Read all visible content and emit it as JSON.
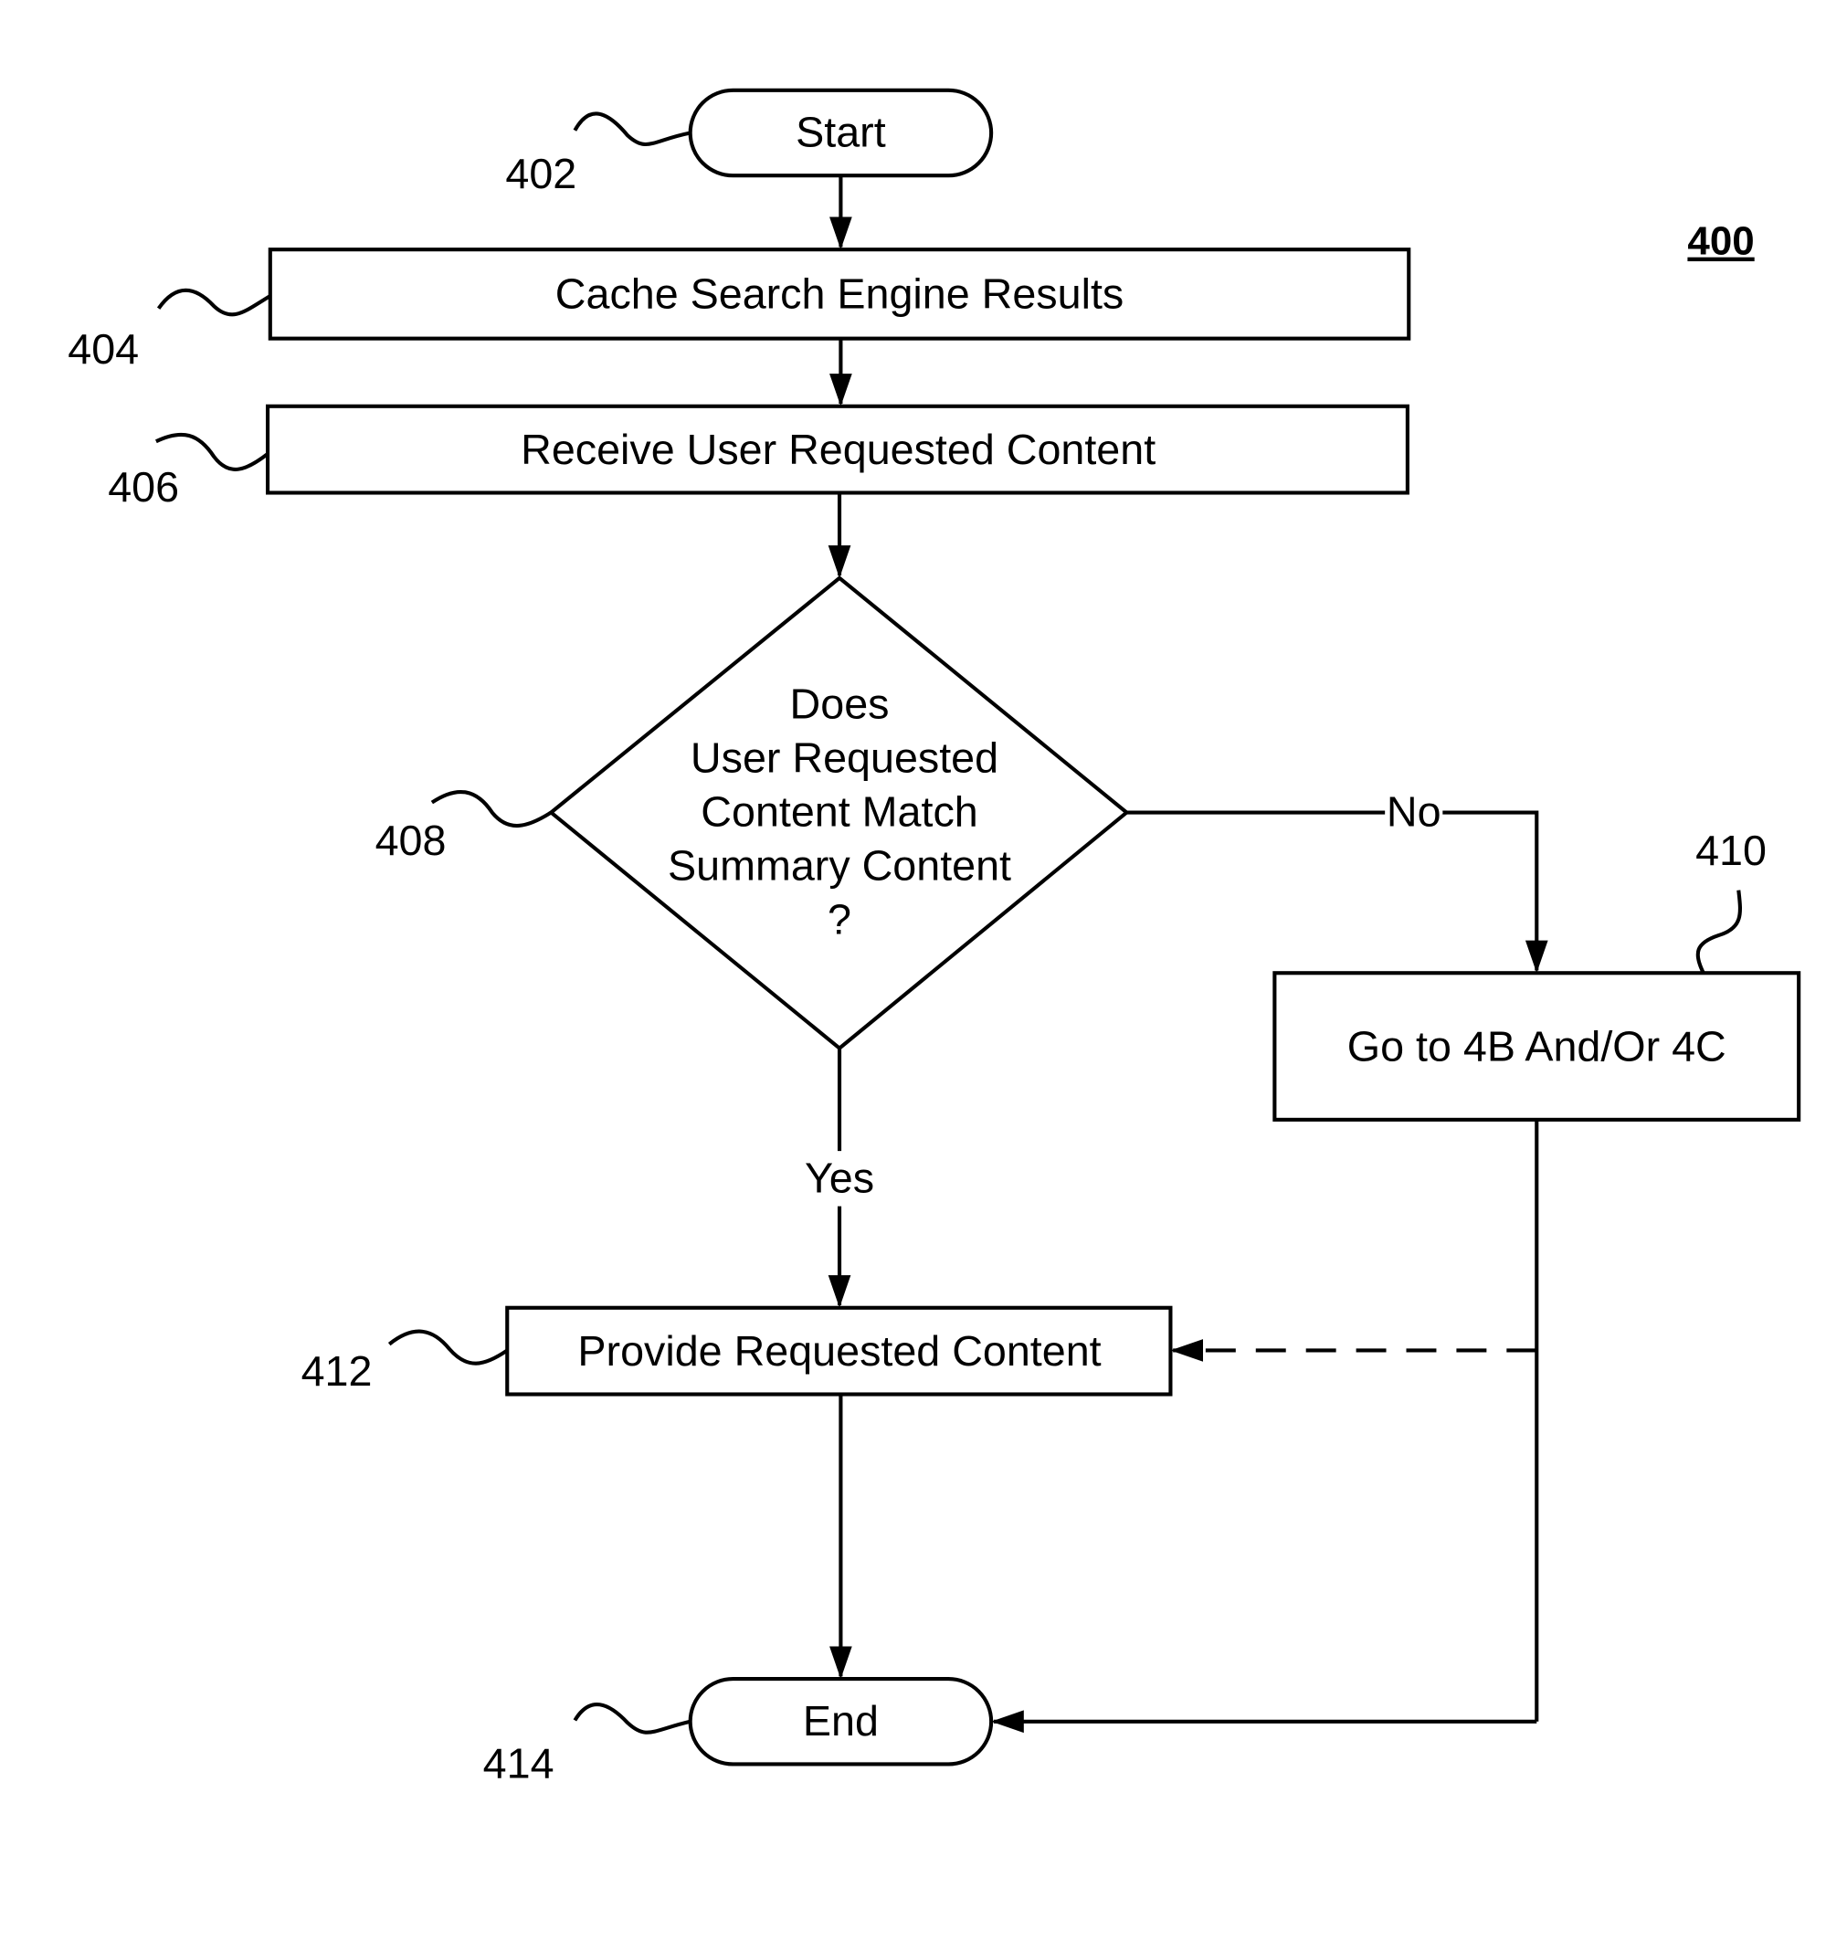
{
  "figure": {
    "number": "400",
    "nodes": {
      "start": {
        "ref": "402",
        "label": "Start"
      },
      "cache": {
        "ref": "404",
        "label": "Cache Search Engine Results"
      },
      "receive": {
        "ref": "406",
        "label": "Receive User Requested Content"
      },
      "decision": {
        "ref": "408",
        "lines": [
          "Does",
          "User Requested",
          "Content Match",
          "Summary Content",
          "?"
        ]
      },
      "goto": {
        "ref": "410",
        "label": "Go to 4B And/Or 4C"
      },
      "provide": {
        "ref": "412",
        "label": "Provide Requested Content"
      },
      "end": {
        "ref": "414",
        "label": "End"
      }
    },
    "edges": {
      "no_label": "No",
      "yes_label": "Yes"
    }
  }
}
